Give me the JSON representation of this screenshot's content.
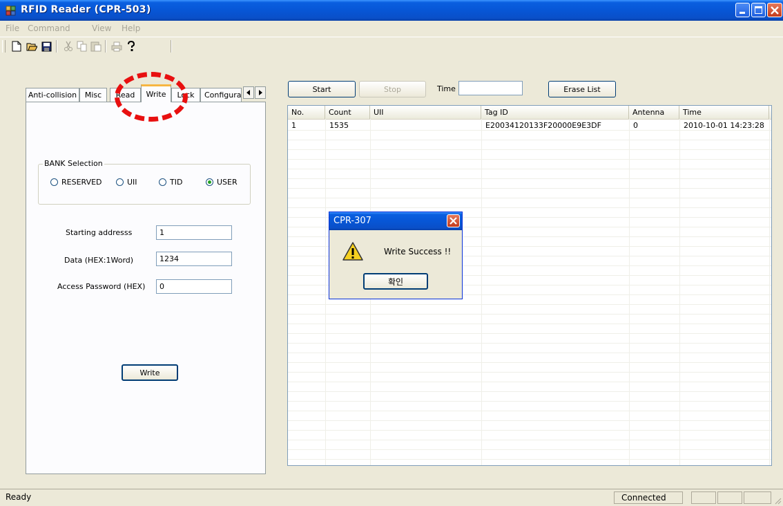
{
  "window": {
    "title": "RFID Reader (CPR-503)",
    "icon": "app-rfid-icon"
  },
  "menu": [
    "File",
    "Command",
    "View",
    "Help"
  ],
  "toolbar": [
    "new-icon",
    "open-icon",
    "save-icon",
    "cut-icon",
    "copy-icon",
    "paste-icon",
    "print-icon",
    "help-icon"
  ],
  "tabs": [
    "Anti-collision",
    "Misc",
    "Read",
    "Write",
    "Lock",
    "Configura"
  ],
  "active_tab": "Write",
  "bank": {
    "title": "BANK Selection",
    "options": [
      "RESERVED",
      "UII",
      "TID",
      "USER"
    ],
    "selected": "USER"
  },
  "form": {
    "start_label": "Starting addresss",
    "start_value": "1",
    "data_label": "Data (HEX:1Word)",
    "data_value": "1234",
    "pwd_label": "Access Password (HEX)",
    "pwd_value": "0",
    "write_button": "Write"
  },
  "controls": {
    "start": "Start",
    "stop": "Stop",
    "time_label": "Time",
    "time_value": "",
    "erase": "Erase List"
  },
  "list": {
    "columns": [
      "No.",
      "Count",
      "UII",
      "Tag ID",
      "Antenna",
      "Time"
    ],
    "rows": [
      [
        "1",
        "1535",
        "",
        "E20034120133F20000E9E3DF",
        "0",
        "2010-10-01 14:23:28"
      ]
    ]
  },
  "dialog": {
    "title": "CPR-307",
    "message": "Write Success !!",
    "ok": "확인"
  },
  "status": {
    "left": "Ready",
    "conn": "Connected"
  },
  "colors": {
    "titlebar": "#0756d6",
    "highlight": "#e81010"
  }
}
